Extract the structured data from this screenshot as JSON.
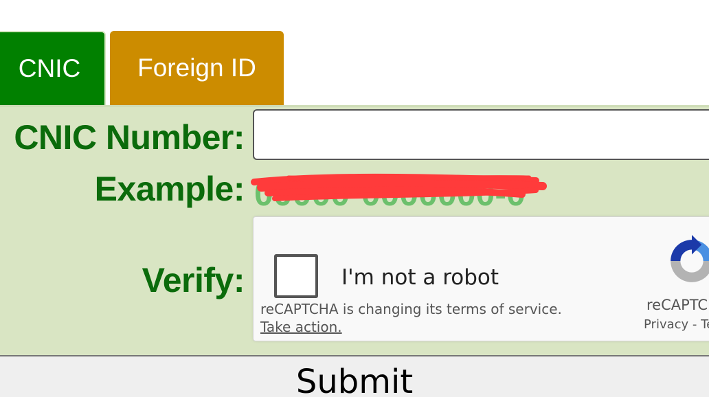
{
  "tabs": [
    {
      "label": "CNIC",
      "active": true,
      "color": "#018000"
    },
    {
      "label": "Foreign ID",
      "active": false,
      "color": "#cc8c00"
    }
  ],
  "form": {
    "cnic_label": "CNIC Number:",
    "cnic_value": "",
    "example_label": "Example:",
    "verify_label": "Verify:",
    "label_color": "#0b6b0b",
    "panel_color": "#d9e5c3"
  },
  "captcha": {
    "checkbox_label": "I'm not a robot",
    "checked": false,
    "notice": "reCAPTCHA is changing its terms of service.",
    "action_link": "Take action.",
    "brand": "reCAPTCHA",
    "privacy_link": "Privacy",
    "separator": "-",
    "terms_link": "Terms",
    "logo_icon": "recaptcha-logo-icon"
  },
  "submit": {
    "label": "Submit"
  }
}
